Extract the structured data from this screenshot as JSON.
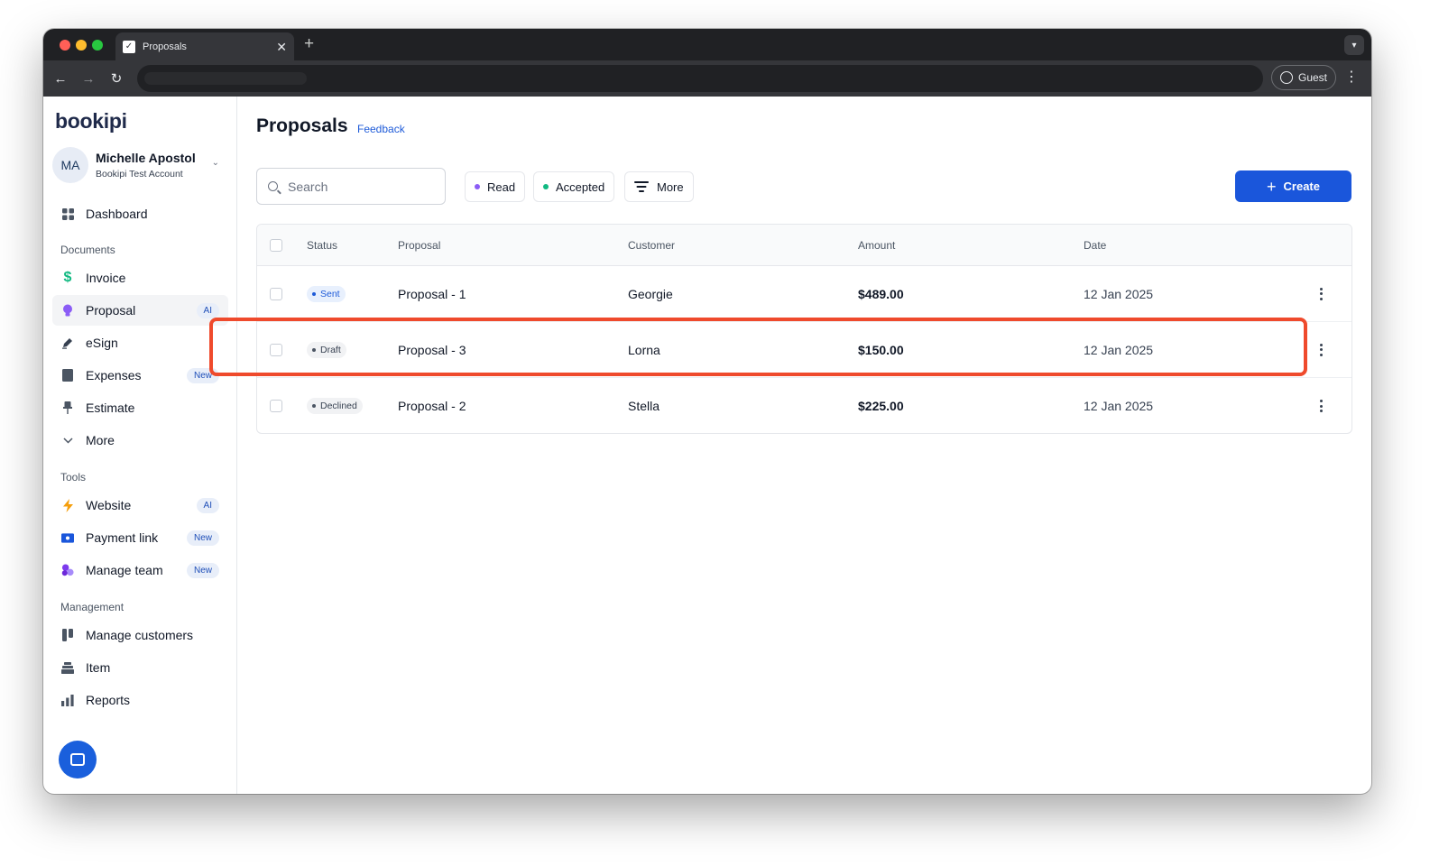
{
  "browser": {
    "tab_title": "Proposals",
    "tab_close": "✕",
    "new_tab": "+",
    "profile_label": "Guest"
  },
  "sidebar": {
    "logo": "bookipi",
    "account": {
      "initials": "MA",
      "name": "Michelle Apostol",
      "subtitle": "Bookipi Test Account"
    },
    "dashboard": {
      "label": "Dashboard",
      "icon": "grid-icon"
    },
    "documents_label": "Documents",
    "documents": [
      {
        "label": "Invoice",
        "icon": "dollar-icon",
        "badge": ""
      },
      {
        "label": "Proposal",
        "icon": "bulb-icon",
        "badge": "AI"
      },
      {
        "label": "eSign",
        "icon": "pen-icon",
        "badge": ""
      },
      {
        "label": "Expenses",
        "icon": "book-icon",
        "badge": "New"
      },
      {
        "label": "Estimate",
        "icon": "pin-icon",
        "badge": ""
      },
      {
        "label": "More",
        "icon": "chevron-down-icon",
        "badge": ""
      }
    ],
    "tools_label": "Tools",
    "tools": [
      {
        "label": "Website",
        "icon": "bolt-icon",
        "badge": "AI"
      },
      {
        "label": "Payment link",
        "icon": "payment-icon",
        "badge": "New"
      },
      {
        "label": "Manage team",
        "icon": "team-icon",
        "badge": "New"
      }
    ],
    "management_label": "Management",
    "management": [
      {
        "label": "Manage customers",
        "icon": "customers-icon"
      },
      {
        "label": "Item",
        "icon": "item-icon"
      },
      {
        "label": "Reports",
        "icon": "bar-chart-icon"
      }
    ]
  },
  "main": {
    "title": "Proposals",
    "feedback_link": "Feedback",
    "search_placeholder": "Search",
    "filters": [
      {
        "label": "Read",
        "dot_color": "#8b5cf6"
      },
      {
        "label": "Accepted",
        "dot_color": "#10b981"
      },
      {
        "label": "More",
        "icon": "filter-icon"
      }
    ],
    "create_label": "Create",
    "table": {
      "columns": [
        "Status",
        "Proposal",
        "Customer",
        "Amount",
        "Date"
      ],
      "rows": [
        {
          "status": "Sent",
          "proposal": "Proposal - 1",
          "customer": "Georgie",
          "amount": "$489.00",
          "date": "12 Jan 2025"
        },
        {
          "status": "Draft",
          "proposal": "Proposal - 3",
          "customer": "Lorna",
          "amount": "$150.00",
          "date": "12 Jan 2025"
        },
        {
          "status": "Declined",
          "proposal": "Proposal - 2",
          "customer": "Stella",
          "amount": "$225.00",
          "date": "12 Jan 2025"
        }
      ]
    }
  },
  "colors": {
    "primary": "#1a56db",
    "highlight": "#ef4a2c",
    "status_sent_bg": "#e8f0fd",
    "status_sent_fg": "#1d5ad8",
    "status_neutral_bg": "#f1f2f4",
    "status_neutral_fg": "#374151",
    "gift": "#5b4fe0"
  }
}
